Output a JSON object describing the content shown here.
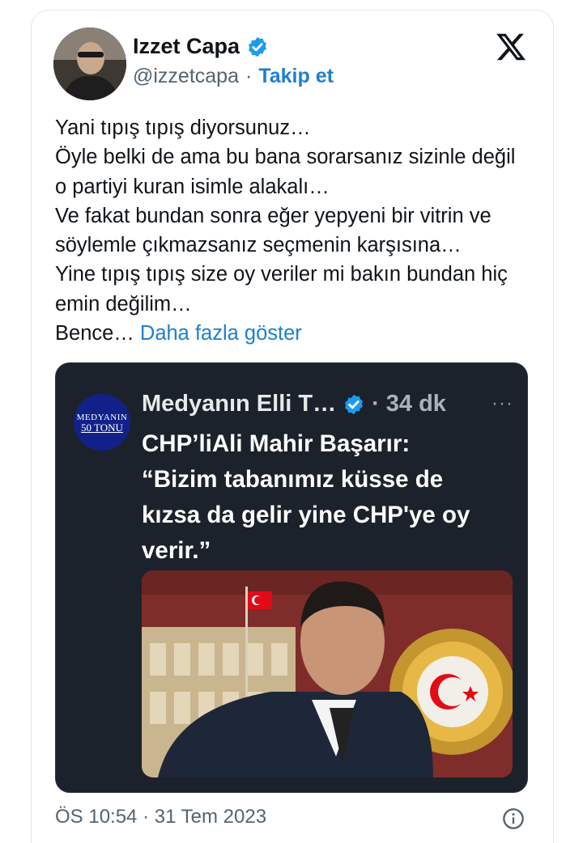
{
  "author": {
    "name": "Izzet Capa",
    "handle": "@izzetcapa",
    "separator": "·",
    "follow_label": "Takip et",
    "avatar_icon": "profile-photo-avatar",
    "verified_icon": "verified-badge-icon"
  },
  "platform_icon": "x-logo-icon",
  "tweet": {
    "lines": [
      "Yani tıpış tıpış diyorsunuz…",
      "Öyle belki de ama bu bana sorarsanız sizinle değil",
      "o partiyi kuran isimle alakalı…",
      "Ve fakat bundan sonra eğer yepyeni bir vitrin ve",
      "söylemle çıkmazsanız seçmenin karşısına…",
      "Yine tıpış tıpış size oy veriler mi bakın bundan hiç",
      "emin değilim…"
    ],
    "last_line_start": "Bence…",
    "show_more": "Daha fazla göster"
  },
  "quoted": {
    "avatar_line1": "MEDYANIN",
    "avatar_line2": "50 TONU",
    "name": "Medyanın Elli T…",
    "separator": "·",
    "time": "34 dk",
    "more": "···",
    "text_lines": [
      "CHP’liAli Mahir Başarır:",
      "“Bizim tabanımız küsse de",
      "kızsa da gelir yine CHP'ye oy",
      "verir.”"
    ]
  },
  "footer": {
    "timestamp": "ÖS 10:54 · 31 Tem 2023",
    "info_icon": "info-icon"
  },
  "colors": {
    "link_blue": "#1d7fd1",
    "verified_blue": "#1d9bf0",
    "quote_bg": "#1c222b",
    "muted": "#536471"
  }
}
